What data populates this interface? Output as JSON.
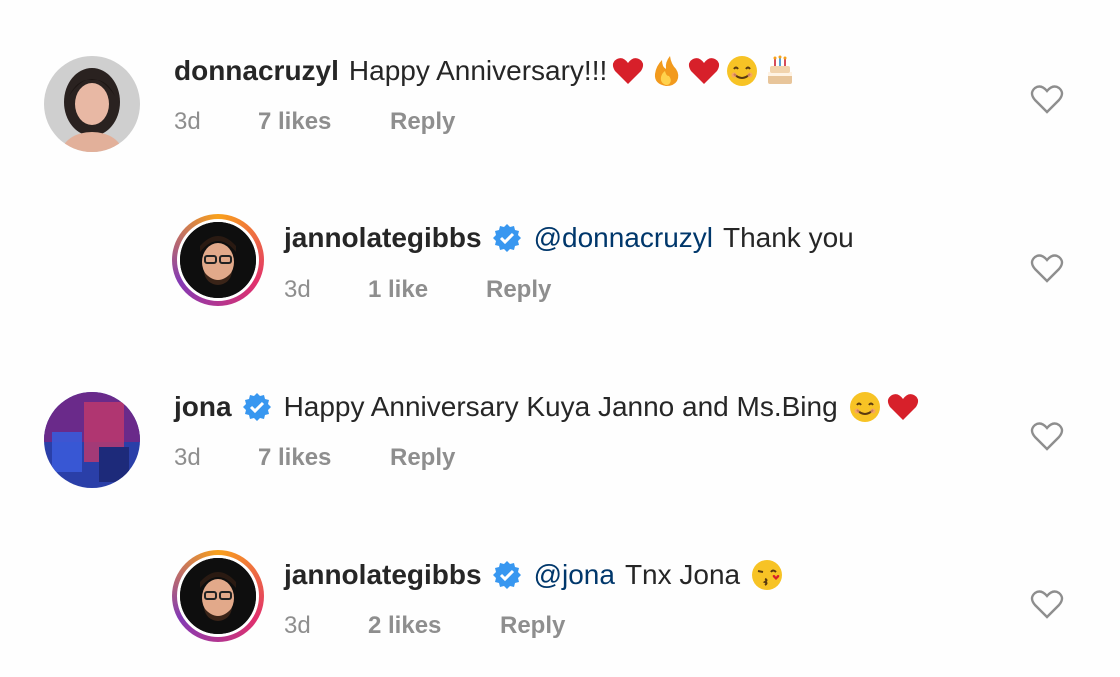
{
  "comments": [
    {
      "username": "donnacruzyl",
      "mention": "",
      "text": "Happy Anniversary!!!",
      "emojis": [
        "red-heart",
        "fire",
        "red-heart",
        "smiling-face",
        "birthday-cake"
      ],
      "time": "3d",
      "likes": "7 likes",
      "reply": "Reply",
      "verified": false
    },
    {
      "username": "jannolategibbs",
      "mention": "@donnacruzyl",
      "text": "Thank you",
      "emojis": [],
      "time": "3d",
      "likes": "1 like",
      "reply": "Reply",
      "verified": true
    },
    {
      "username": "jona",
      "mention": "",
      "text": "Happy Anniversary Kuya Janno and Ms.Bing",
      "emojis": [
        "smiling-face",
        "red-heart"
      ],
      "time": "3d",
      "likes": "7 likes",
      "reply": "Reply",
      "verified": true
    },
    {
      "username": "jannolategibbs",
      "mention": "@jona",
      "text": "Tnx Jona",
      "emojis": [
        "face-blowing-kiss"
      ],
      "time": "3d",
      "likes": "2 likes",
      "reply": "Reply",
      "verified": true
    }
  ],
  "colors": {
    "username": "#262626",
    "mention": "#00376b",
    "meta": "#8e8e8e",
    "verified": "#3897f0",
    "heart_outline": "#8e8e8e"
  }
}
